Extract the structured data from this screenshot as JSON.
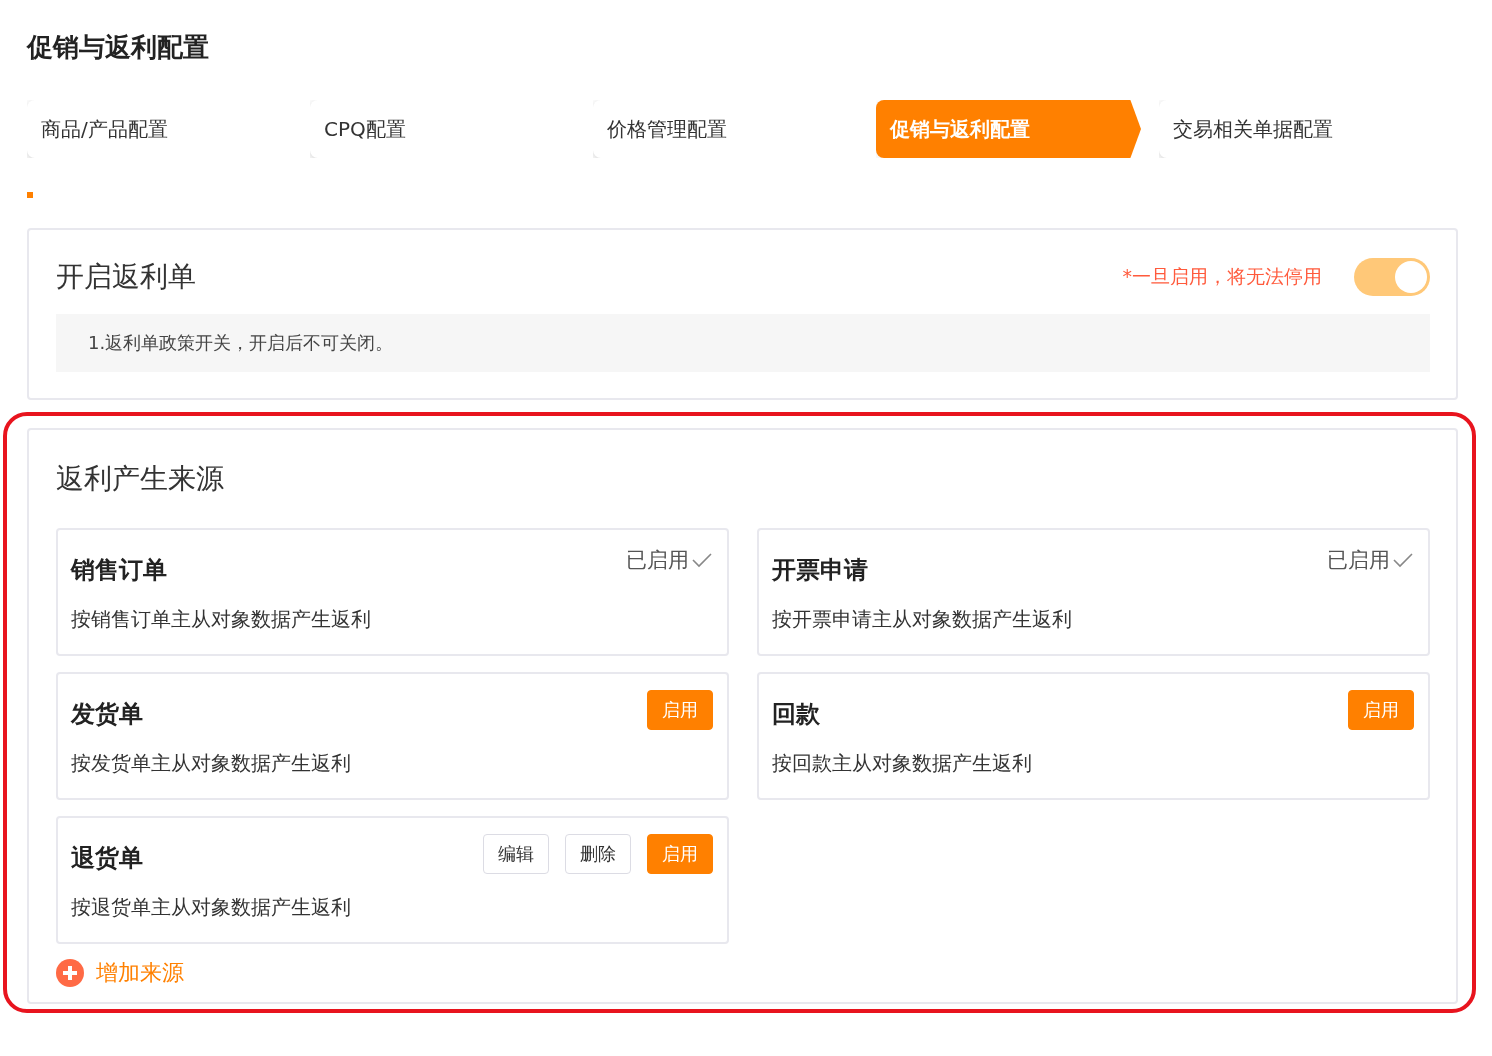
{
  "page_title": "促销与返利配置",
  "steps": [
    {
      "label": "商品/产品配置",
      "selected": false
    },
    {
      "label": "CPQ配置",
      "selected": false
    },
    {
      "label": "价格管理配置",
      "selected": false
    },
    {
      "label": "促销与返利配置",
      "selected": true
    },
    {
      "label": "交易相关单据配置",
      "selected": false
    }
  ],
  "rebate_switch": {
    "title": "开启返利单",
    "warning": "*一旦启用，将无法停用",
    "on": true,
    "disabled": true,
    "note": "1.返利单政策开关，开启后不可关闭。"
  },
  "sources": {
    "title": "返利产生来源",
    "items": [
      {
        "name": "销售订单",
        "description": "按销售订单主从对象数据产生返利",
        "kind": "enabled",
        "status": "已启用"
      },
      {
        "name": "开票申请",
        "description": "按开票申请主从对象数据产生返利",
        "kind": "enabled",
        "status": "已启用"
      },
      {
        "name": "发货单",
        "description": "按发货单主从对象数据产生返利",
        "kind": "actions",
        "buttons": [
          {
            "label": "启用",
            "primary": true
          }
        ]
      },
      {
        "name": "回款",
        "description": "按回款主从对象数据产生返利",
        "kind": "actions",
        "buttons": [
          {
            "label": "启用",
            "primary": true
          }
        ]
      },
      {
        "name": "退货单",
        "description": "按退货单主从对象数据产生返利",
        "kind": "actions",
        "buttons": [
          {
            "label": "编辑",
            "primary": false
          },
          {
            "label": "删除",
            "primary": false
          },
          {
            "label": "启用",
            "primary": true
          }
        ]
      }
    ],
    "add_label": "增加来源"
  }
}
